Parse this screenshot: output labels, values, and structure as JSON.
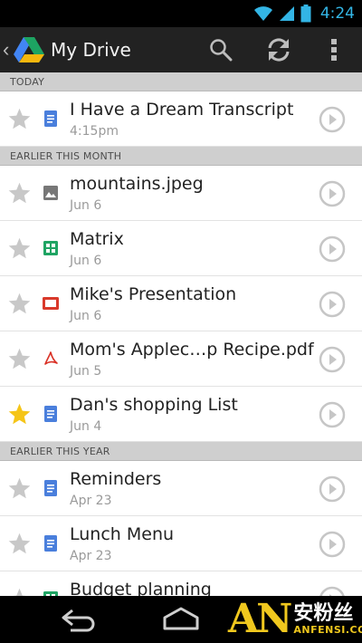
{
  "status_bar": {
    "time": "4:24"
  },
  "action_bar": {
    "title": "My Drive"
  },
  "sections": [
    {
      "header": "TODAY",
      "items": [
        {
          "title": "I Have a Dream Transcript",
          "date": "4:15pm",
          "type": "document",
          "starred": false
        }
      ]
    },
    {
      "header": "EARLIER THIS MONTH",
      "items": [
        {
          "title": "mountains.jpeg",
          "date": "Jun 6",
          "type": "image",
          "starred": false
        },
        {
          "title": "Matrix",
          "date": "Jun 6",
          "type": "spreadsheet",
          "starred": false
        },
        {
          "title": "Mike's Presentation",
          "date": "Jun 6",
          "type": "presentation",
          "starred": false
        },
        {
          "title": "Mom's Applec…p Recipe.pdf",
          "date": "Jun 5",
          "type": "pdf",
          "starred": false
        },
        {
          "title": "Dan's shopping List",
          "date": "Jun 4",
          "type": "document",
          "starred": true
        }
      ]
    },
    {
      "header": "EARLIER THIS YEAR",
      "items": [
        {
          "title": "Reminders",
          "date": "Apr 23",
          "type": "document",
          "starred": false
        },
        {
          "title": "Lunch Menu",
          "date": "Apr 23",
          "type": "document",
          "starred": false
        },
        {
          "title": "Budget planning",
          "date": "",
          "type": "spreadsheet",
          "starred": false
        }
      ]
    }
  ],
  "icons": {
    "document": "document-icon",
    "image": "image-icon",
    "spreadsheet": "spreadsheet-icon",
    "presentation": "presentation-icon",
    "pdf": "pdf-icon"
  },
  "colors": {
    "action_bar": "#222222",
    "status_accent": "#33b5e5",
    "section_header": "#cfcfcf",
    "star_on": "#f5c518",
    "star_off": "#c8c8c8",
    "doc_blue": "#4a7fdc",
    "sheet_green": "#1fa463",
    "slide_red": "#d9392b",
    "pdf_red": "#d93025"
  },
  "watermark": {
    "logo": "AN",
    "cn": "安粉丝",
    "en": "ANFENSI.COM"
  }
}
